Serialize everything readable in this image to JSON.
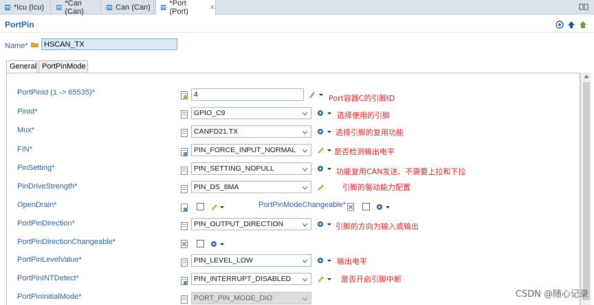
{
  "tabs": [
    {
      "label": "*Icu (Icu)",
      "active": false
    },
    {
      "label": "*Can (Can)",
      "active": false
    },
    {
      "label": "Can (Can)",
      "active": false
    },
    {
      "label": "*Port (Port)",
      "active": true
    }
  ],
  "title": "PortPin",
  "name": {
    "label": "Name*",
    "value": "HSCAN_TX"
  },
  "subtabs": [
    "General",
    "PortPinMode"
  ],
  "fields": {
    "pinid_num": {
      "label": "PortPinId (1 -> 65535)*",
      "value": "4",
      "note": "Port容器C的引脚ID"
    },
    "pinid": {
      "label": "PinId*",
      "value": "GPIO_C9",
      "note": "选择使用的引脚"
    },
    "mux": {
      "label": "Mux*",
      "value": "CANFD21.TX",
      "note": "选择引脚的复用功能"
    },
    "fin": {
      "label": "FIN*",
      "value": "PIN_FORCE_INPUT_NORMAL",
      "note": "是否检测输出电平"
    },
    "setting": {
      "label": "PinSetting*",
      "value": "PIN_SETTING_NOPULL",
      "note": "功能复用CAN发送、不需要上拉和下拉"
    },
    "drive": {
      "label": "PinDriveStrength*",
      "value": "PIN_DS_8MA",
      "note": "引脚的驱动能力配置"
    },
    "opendrain": {
      "label": "OpenDrain*"
    },
    "modechangeable": {
      "label": "PortPinModeChangeable*"
    },
    "direction": {
      "label": "PortPinDirection*",
      "value": "PIN_OUTPUT_DIRECTION",
      "note": "引脚的方向为输入或输出"
    },
    "dirchangeable": {
      "label": "PortPinDirectionChangeable*"
    },
    "level": {
      "label": "PortPinLevelValue*",
      "value": "PIN_LEVEL_LOW",
      "note": "输出电平"
    },
    "intdetect": {
      "label": "PortPinINTDetect*",
      "value": "PIN_INTERRUPT_DISABLED",
      "note": "是否开启引脚中断"
    },
    "initmode": {
      "label": "PortPinInitialMode*",
      "value": "PORT_PIN_MODE_DIO"
    }
  },
  "watermark": "CSDN @随心记录",
  "colors": {
    "label": "#2a5fa8",
    "note": "#e32020",
    "title": "#2a5fa8"
  },
  "icons": [
    "tab-file-icon",
    "tab-close-icon",
    "maximize-icon",
    "help-icon",
    "up-icon",
    "home-icon",
    "folder-icon",
    "doc-icon",
    "pencil-icon",
    "gear-icon",
    "checkbox"
  ]
}
